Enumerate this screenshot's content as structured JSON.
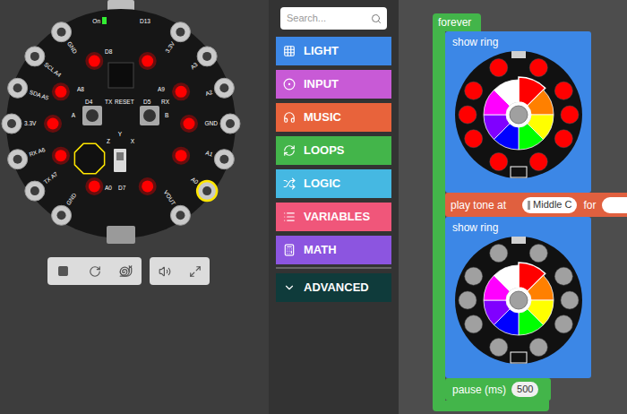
{
  "simulator": {
    "power_led": {
      "label": "On",
      "on": true
    },
    "pads_left": [
      {
        "label": "GND",
        "highlighted": false
      },
      {
        "label": "SCL A4",
        "highlighted": false
      },
      {
        "label": "SDA A5",
        "highlighted": false
      },
      {
        "label": "3.3V",
        "highlighted": false
      },
      {
        "label": "RX A6",
        "highlighted": false
      },
      {
        "label": "TX A7",
        "highlighted": false
      },
      {
        "label": "GND",
        "highlighted": false
      }
    ],
    "pads_right": [
      {
        "label": "3.3V",
        "highlighted": false
      },
      {
        "label": "A3",
        "highlighted": false
      },
      {
        "label": "A2",
        "highlighted": false
      },
      {
        "label": "GND",
        "highlighted": false
      },
      {
        "label": "A1",
        "highlighted": false
      },
      {
        "label": "A0",
        "highlighted": true
      },
      {
        "label": "VOUT",
        "highlighted": false
      }
    ],
    "neopixels": [
      "#ff0000",
      "#ff0000",
      "#ff0000",
      "#ff0000",
      "#ff0000",
      "#ff0000",
      "#ff0000",
      "#ff0000",
      "#ff0000",
      "#ff0000"
    ],
    "labels": [
      "D13",
      "D8",
      "A8",
      "A9",
      "D4",
      "D5",
      "TX",
      "RESET",
      "RX",
      "D7",
      "A0",
      "A",
      "B",
      "Y",
      "Z",
      "X"
    ]
  },
  "toolbox": {
    "search": {
      "placeholder": "Search..."
    },
    "categories": [
      {
        "label": "LIGHT",
        "color": "#3c87e6"
      },
      {
        "label": "INPUT",
        "color": "#c85ad6"
      },
      {
        "label": "MUSIC",
        "color": "#e8633b"
      },
      {
        "label": "LOOPS",
        "color": "#43b54a"
      },
      {
        "label": "LOGIC",
        "color": "#45b8e2"
      },
      {
        "label": "VARIABLES",
        "color": "#f0567a"
      },
      {
        "label": "MATH",
        "color": "#8c55e0"
      }
    ],
    "advanced": {
      "label": "ADVANCED",
      "expanded": false
    }
  },
  "workspace": {
    "forever": {
      "label": "forever",
      "blocks": [
        {
          "kind": "ring",
          "label": "show ring",
          "leds": [
            "#ff0000",
            "#ff0000",
            "#ff0000",
            "#ff0000",
            "#ff0000",
            "#ff0000",
            "#ff0000",
            "#ff0000",
            "#ff0000",
            "#ff0000"
          ],
          "palette": [
            {
              "color": "#ff0000",
              "selected": true
            },
            {
              "color": "#ff8000",
              "selected": false
            },
            {
              "color": "#ffff00",
              "selected": false
            },
            {
              "color": "#00ff00",
              "selected": false
            },
            {
              "color": "#0000ff",
              "selected": false
            },
            {
              "color": "#8000ff",
              "selected": false
            },
            {
              "color": "#ff00ff",
              "selected": false
            },
            {
              "color": "#ffffff",
              "selected": false
            }
          ]
        },
        {
          "kind": "tone",
          "label": "play tone at",
          "note": "Middle C",
          "for_label": "for"
        },
        {
          "kind": "ring",
          "label": "show ring",
          "leds": [
            "#a0a0a0",
            "#a0a0a0",
            "#a0a0a0",
            "#a0a0a0",
            "#a0a0a0",
            "#a0a0a0",
            "#a0a0a0",
            "#a0a0a0",
            "#a0a0a0",
            "#a0a0a0"
          ],
          "palette": [
            {
              "color": "#ff0000",
              "selected": true
            },
            {
              "color": "#ff8000",
              "selected": false
            },
            {
              "color": "#ffff00",
              "selected": false
            },
            {
              "color": "#00ff00",
              "selected": false
            },
            {
              "color": "#0000ff",
              "selected": false
            },
            {
              "color": "#8000ff",
              "selected": false
            },
            {
              "color": "#ff00ff",
              "selected": false
            },
            {
              "color": "#ffffff",
              "selected": false
            }
          ]
        },
        {
          "kind": "pause",
          "label": "pause (ms)",
          "value": "500"
        }
      ]
    }
  }
}
